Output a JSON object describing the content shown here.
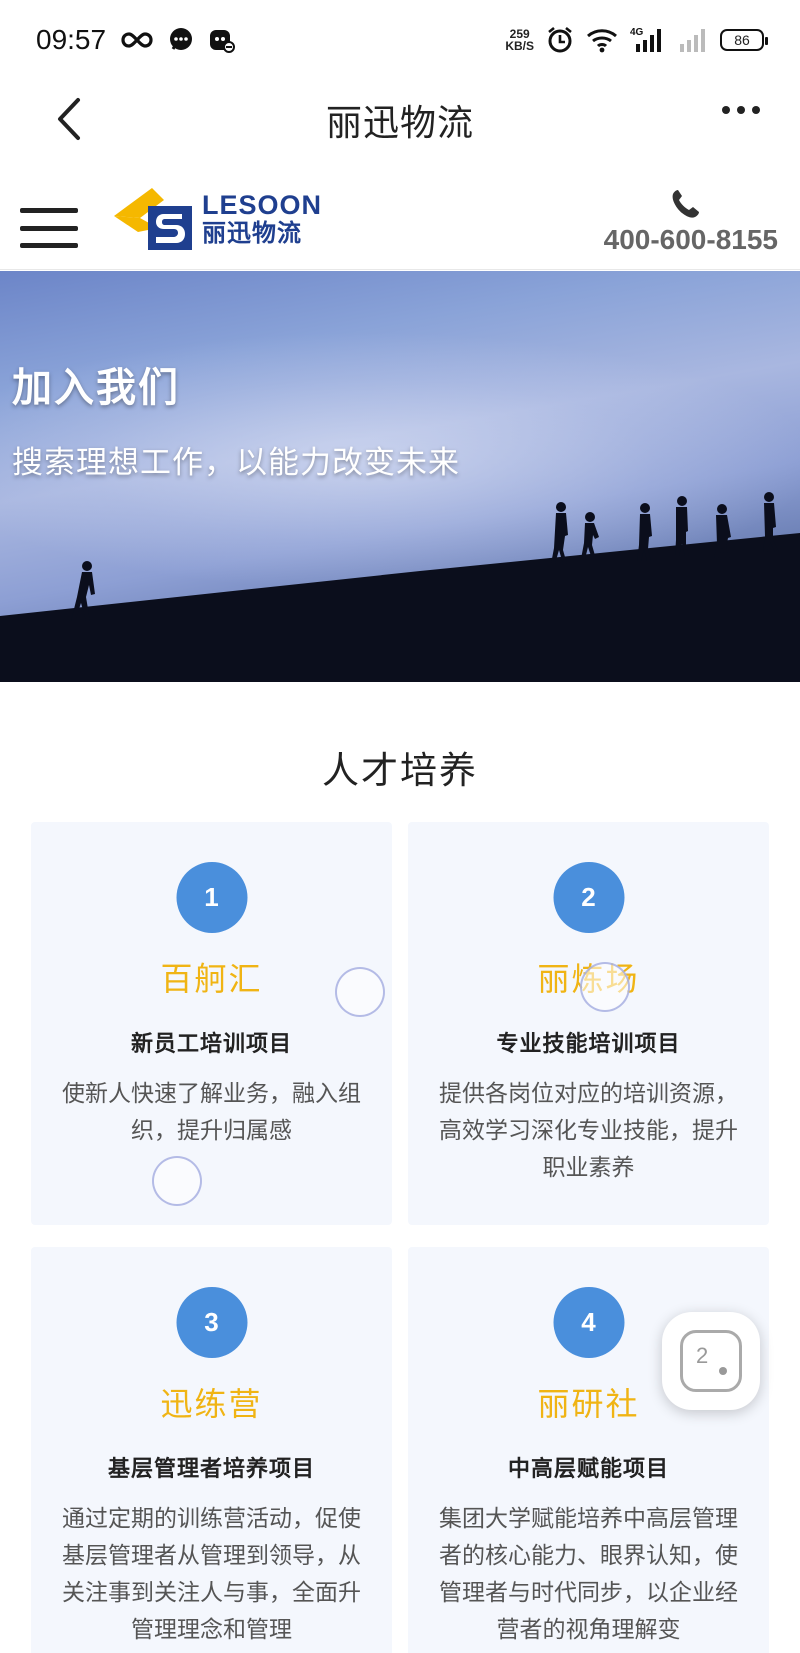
{
  "status_bar": {
    "time": "09:57",
    "net_speed_value": "259",
    "net_speed_unit": "KB/S",
    "network_type": "4G",
    "battery": "86",
    "icons": [
      "infinity-icon",
      "chat-icon",
      "robot-icon",
      "alarm-icon",
      "wifi-icon",
      "signal-icon",
      "signal-empty-icon",
      "battery-icon"
    ]
  },
  "nav": {
    "title": "丽迅物流"
  },
  "header": {
    "logo_en": "LESOON",
    "logo_cn": "丽迅物流",
    "phone": "400-600-8155"
  },
  "banner": {
    "title": "加入我们",
    "subtitle": "搜索理想工作，以能力改变未来"
  },
  "section": {
    "title": "人才培养"
  },
  "cards": [
    {
      "num": "1",
      "name": "百舸汇",
      "subtitle": "新员工培训项目",
      "desc": "使新人快速了解业务，融入组织，提升归属感"
    },
    {
      "num": "2",
      "name": "丽炼场",
      "subtitle": "专业技能培训项目",
      "desc": "提供各岗位对应的培训资源，高效学习深化专业技能，提升职业素养"
    },
    {
      "num": "3",
      "name": "迅练营",
      "subtitle": "基层管理者培养项目",
      "desc": "通过定期的训练营活动，促使基层管理者从管理到领导，从关注事到关注人与事，全面升管理理念和管理"
    },
    {
      "num": "4",
      "name": "丽研社",
      "subtitle": "中高层赋能项目",
      "desc": "集团大学赋能培养中高层管理者的核心能力、眼界认知，使管理者与时代同步，以企业经营者的视角理解变"
    }
  ],
  "floating_button": {
    "label": "2"
  },
  "colors": {
    "accent_blue": "#4a8fdc",
    "accent_yellow": "#f0b414",
    "logo_blue": "#1f3f8f",
    "card_bg": "#f4f7fd"
  }
}
